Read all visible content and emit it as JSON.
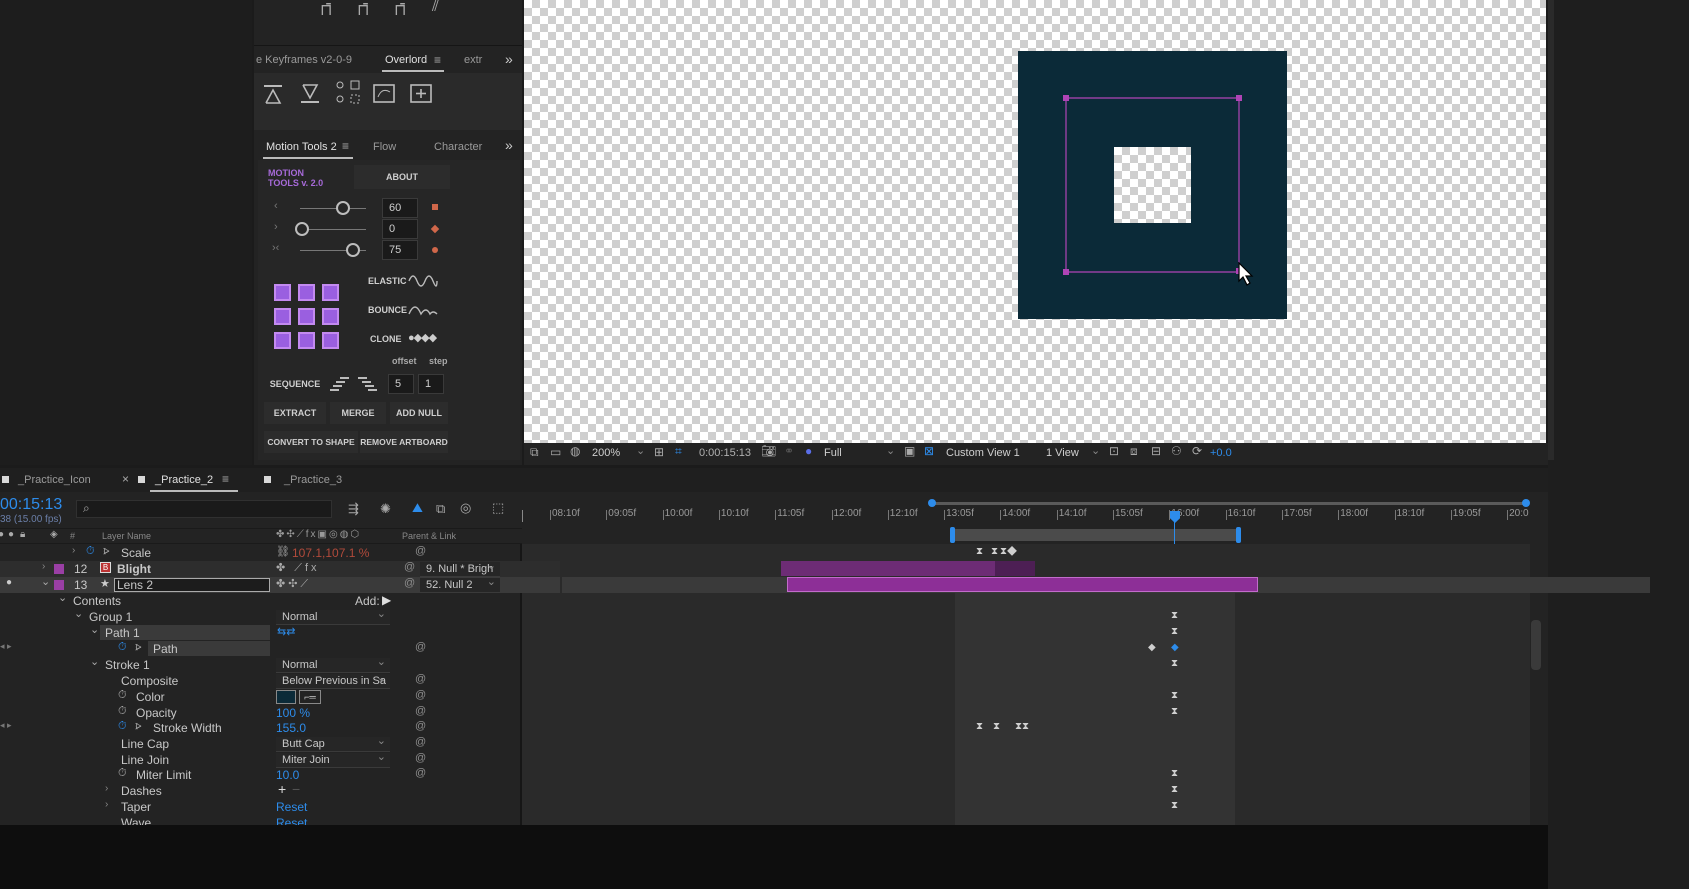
{
  "toolbar_top": {
    "icons": [
      "pin-tool-icon",
      "pin-tool-icon",
      "pin-tool-icon",
      "pen-tool-icon"
    ]
  },
  "keyframes_panel": {
    "tabs": [
      "e Keyframes v2-0-9",
      "Overlord",
      "extr"
    ],
    "active_tab": "Overlord",
    "icons": [
      "align-top-icon",
      "align-bottom-icon",
      "nodes-icon",
      "shape-to-layer-icon",
      "add-shape-icon"
    ]
  },
  "motion_tools": {
    "tabs": [
      "Motion Tools 2",
      "Flow",
      "Character"
    ],
    "logo_line1": "MOTION",
    "logo_line2": "TOOLS v. 2.0",
    "about": "ABOUT",
    "slider1_value": "60",
    "slider2_value": "0",
    "slider3_value": "75",
    "elastic": "ELASTIC",
    "bounce": "BOUNCE",
    "clone": "CLONE",
    "offset": "offset",
    "step": "step",
    "sequence": "SEQUENCE",
    "seq_val1": "5",
    "seq_val2": "1",
    "extract": "EXTRACT",
    "merge": "MERGE",
    "add_null": "ADD NULL",
    "convert": "CONVERT TO SHAPE",
    "remove_artboard": "REMOVE ARTBOARD"
  },
  "viewer": {
    "zoom": "200%",
    "timecode": "0:00:15:13",
    "resolution": "Full",
    "view": "Custom View 1",
    "view_count": "1 View",
    "exposure": "+0.0",
    "shape_fill": "#0b2a38",
    "path_color": "#b044b6"
  },
  "comp_tabs": [
    "_Practice_Icon",
    "_Practice_2",
    "_Practice_3"
  ],
  "timeline": {
    "current_time": "00:15:13",
    "fps": "38 (15.00 fps)",
    "search_placeholder": "",
    "ruler": [
      "08:10f",
      "09:05f",
      "10:00f",
      "10:10f",
      "11:05f",
      "12:00f",
      "12:10f",
      "13:05f",
      "14:00f",
      "14:10f",
      "15:05f",
      "16:00f",
      "16:10f",
      "17:05f",
      "18:00f",
      "18:10f",
      "19:05f",
      "20:0"
    ],
    "header": {
      "hash": "#",
      "layer_name": "Layer Name",
      "parent": "Parent & Link"
    },
    "scale_label": "Scale",
    "scale_value": "107.1,107.1 %",
    "layers": [
      {
        "num": "12",
        "name": "Blight",
        "parent": "9. Null * Brigh"
      },
      {
        "num": "13",
        "name": "Lens 2",
        "parent": "52. Null 2"
      }
    ],
    "contents": "Contents",
    "add": "Add:",
    "group1": "Group 1",
    "group1_mode": "Normal",
    "path1": "Path 1",
    "path": "Path",
    "stroke1": "Stroke 1",
    "stroke1_mode": "Normal",
    "composite": "Composite",
    "composite_value": "Below Previous in Sa",
    "color": "Color",
    "opacity": "Opacity",
    "opacity_value": "100 %",
    "stroke_width": "Stroke Width",
    "stroke_width_value": "155.0",
    "line_cap": "Line Cap",
    "line_cap_value": "Butt Cap",
    "line_join": "Line Join",
    "line_join_value": "Miter Join",
    "miter_limit": "Miter Limit",
    "miter_limit_value": "10.0",
    "dashes": "Dashes",
    "taper": "Taper",
    "taper_value": "Reset",
    "wave": "Wave",
    "wave_value": "Reset"
  }
}
